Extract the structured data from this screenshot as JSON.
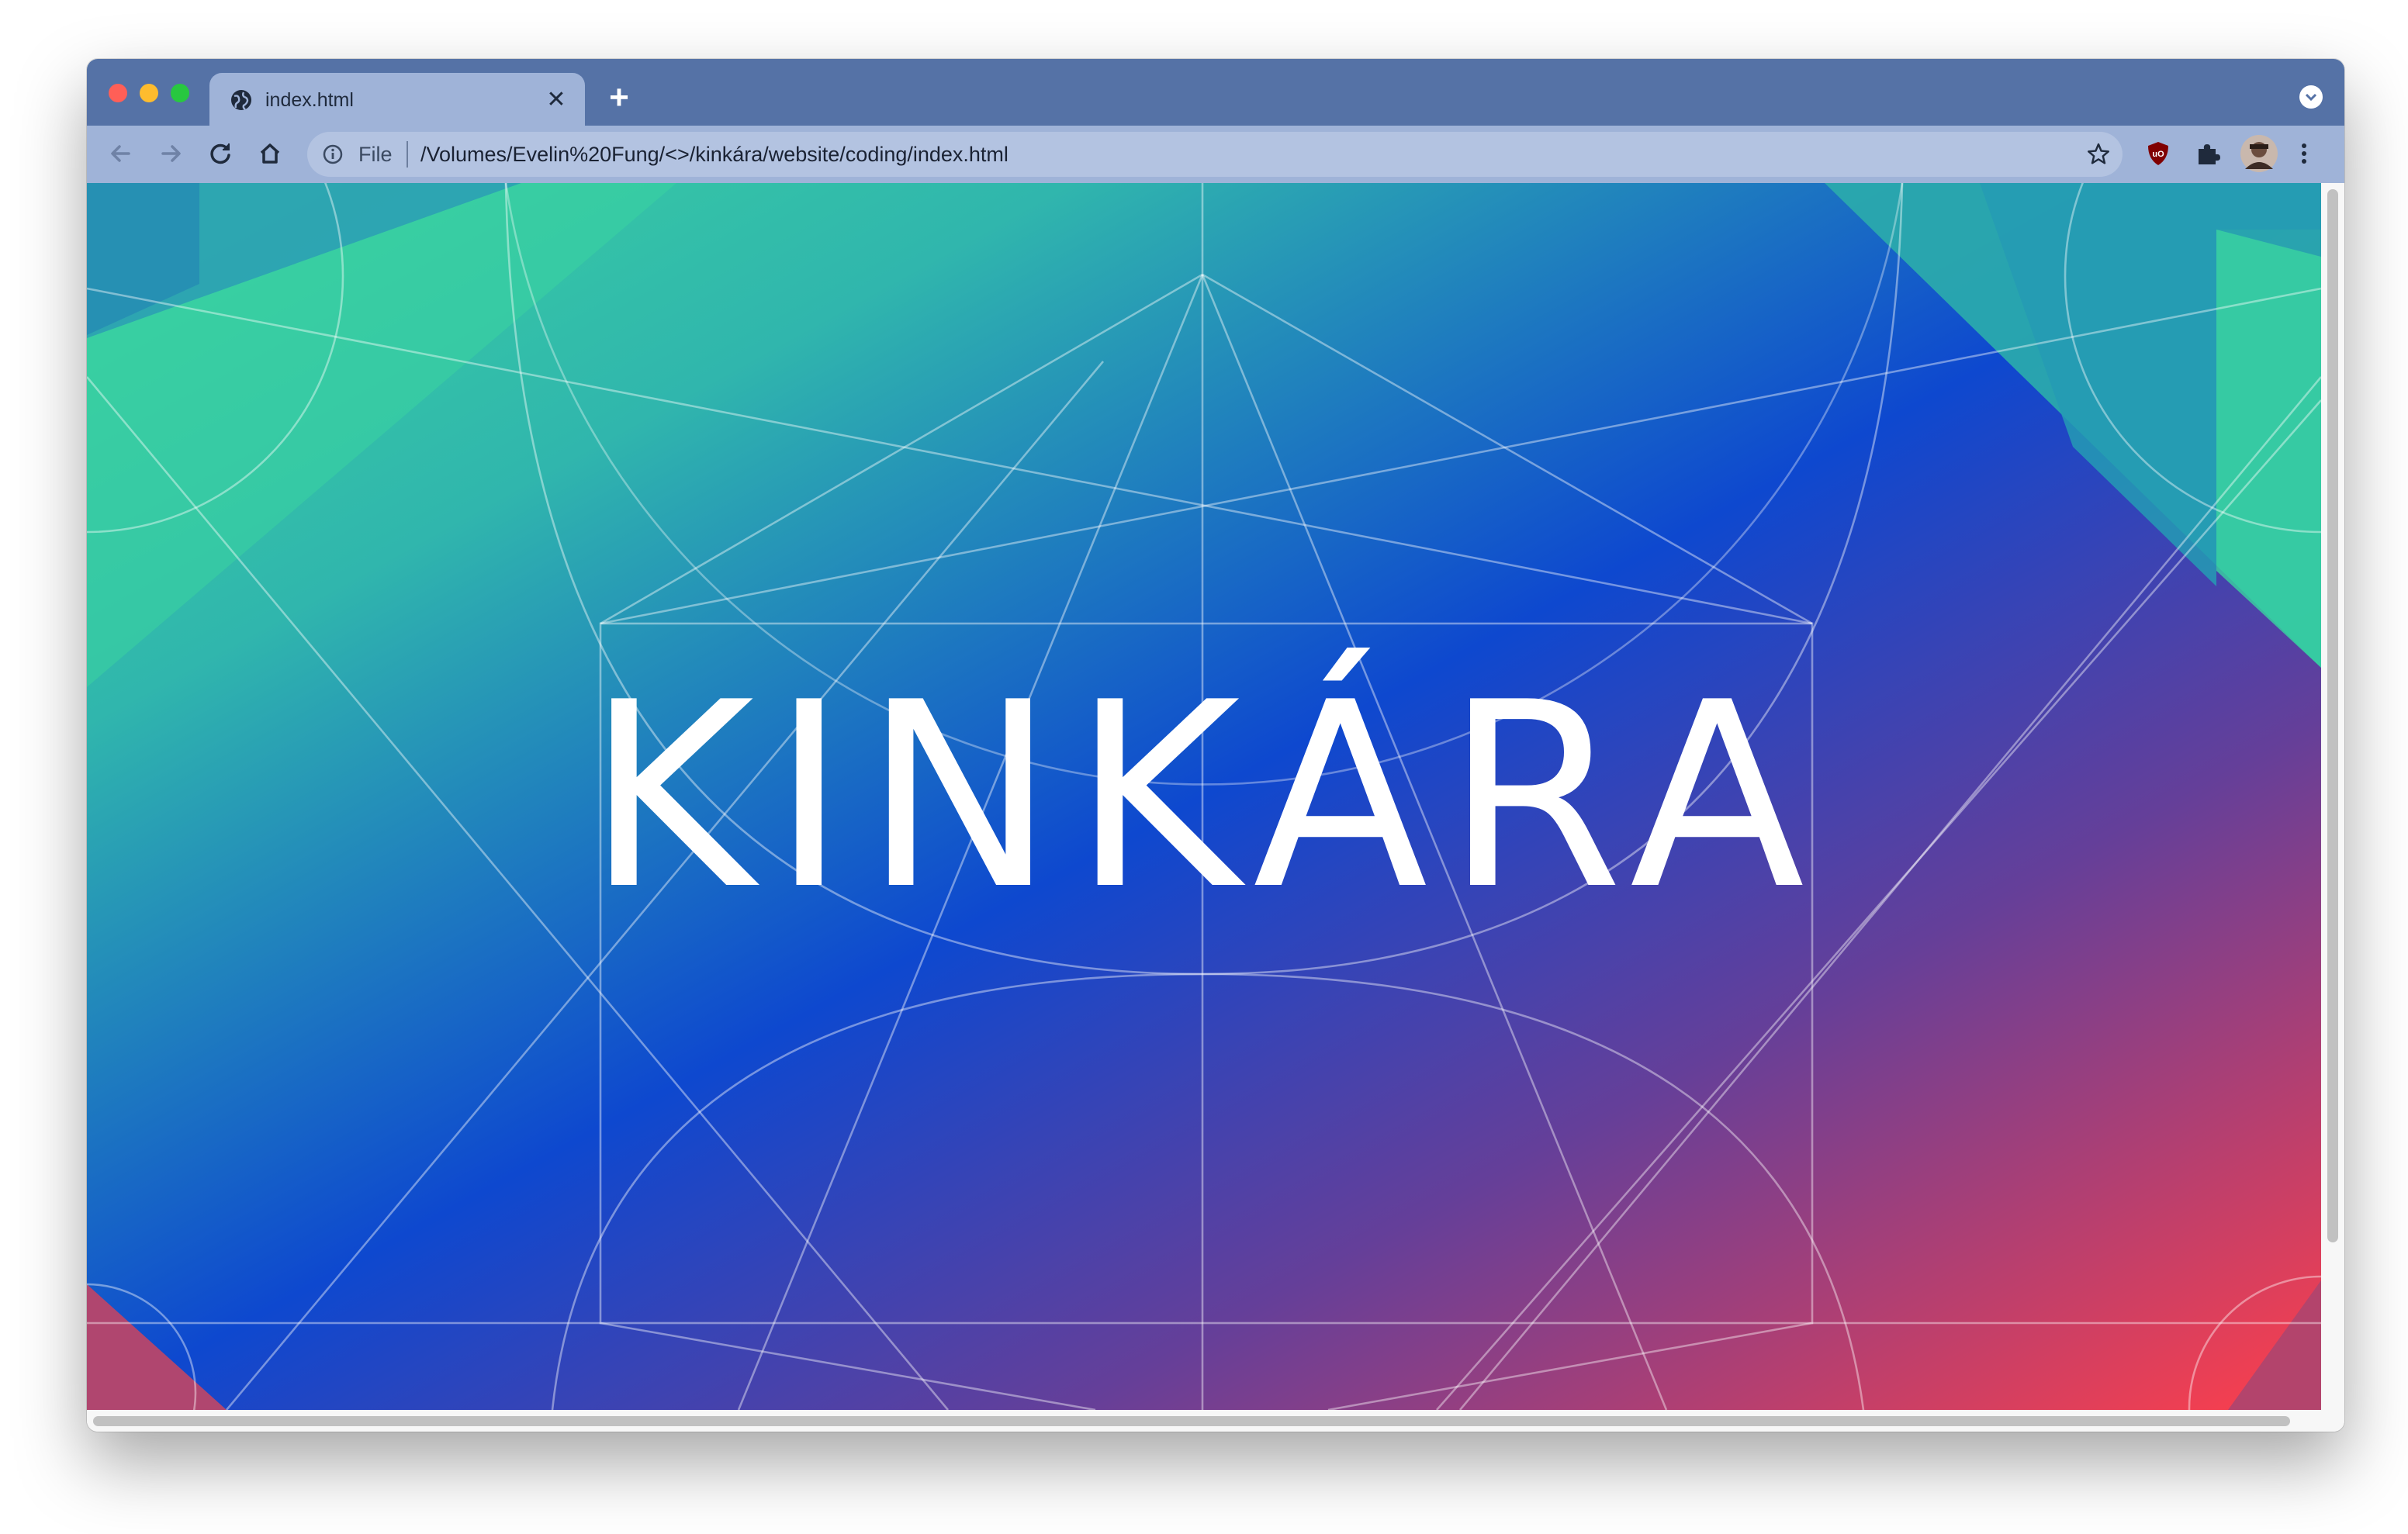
{
  "tab": {
    "title": "index.html",
    "close_glyph": "✕",
    "favicon": "globe-icon"
  },
  "new_tab_glyph": "+",
  "toolbar": {
    "scheme": "File",
    "url": "/Volumes/Evelin%20Fung/<>/kinkára/website/coding/index.html",
    "extensions": [
      "ublock-origin-icon",
      "extensions-puzzle-icon",
      "profile-avatar"
    ]
  },
  "page": {
    "wordmark": "KINKÁRA"
  },
  "colors": {
    "tabstrip": "#5572a6",
    "toolbar": "#9fb3d8",
    "gradient_green": "#3ad3a0",
    "gradient_blue": "#0e48cf",
    "gradient_red": "#ff3f4a",
    "teal": "#27a7b0"
  }
}
